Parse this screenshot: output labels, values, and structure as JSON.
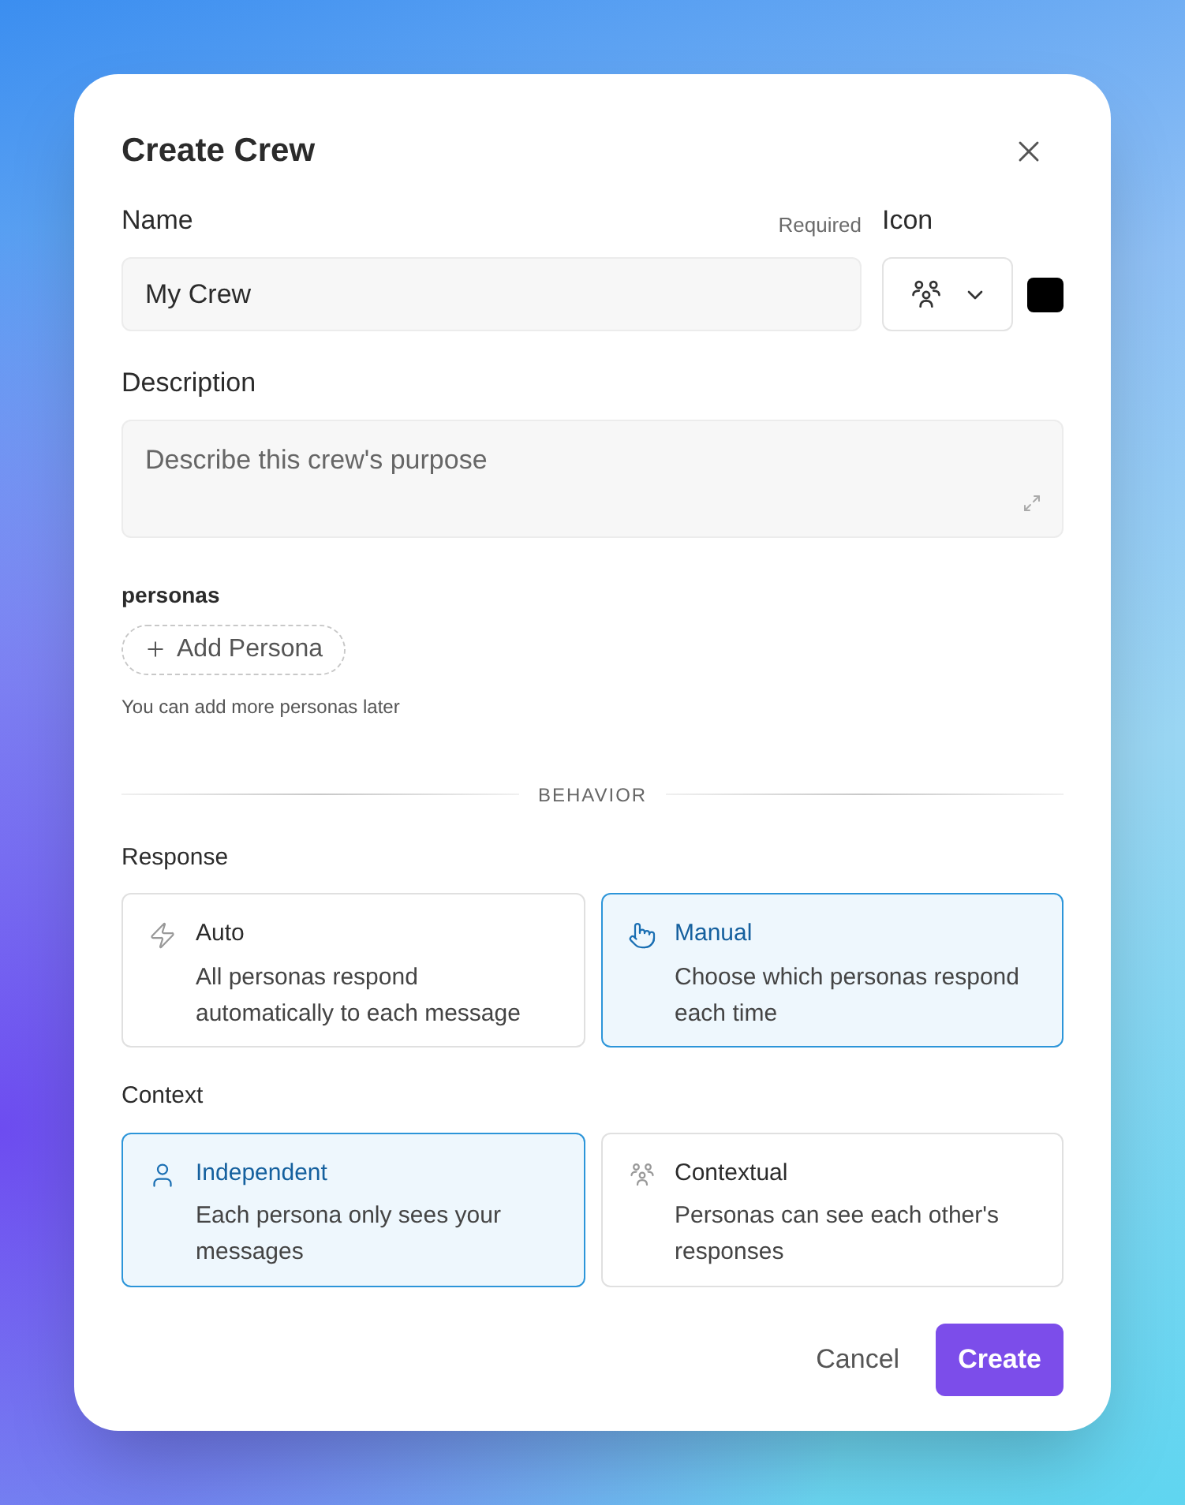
{
  "dialog": {
    "title": "Create Crew"
  },
  "name_field": {
    "label": "Name",
    "hint": "Required",
    "value": "My Crew"
  },
  "icon_picker": {
    "label": "Icon",
    "color": "#000000"
  },
  "description_field": {
    "label": "Description",
    "placeholder": "Describe this crew's purpose"
  },
  "personas": {
    "label": "personas",
    "add_button": "Add Persona",
    "helper": "You can add more personas later"
  },
  "divider": "BEHAVIOR",
  "option_groups": [
    {
      "label": "Response",
      "options": [
        {
          "title": "Auto",
          "description": "All personas respond automatically to each message",
          "selected": false
        },
        {
          "title": "Manual",
          "description": "Choose which personas respond each time",
          "selected": true
        }
      ]
    },
    {
      "label": "Context",
      "options": [
        {
          "title": "Independent",
          "description": "Each persona only sees your messages",
          "selected": true
        },
        {
          "title": "Contextual",
          "description": "Personas can see each other's responses",
          "selected": false
        }
      ]
    }
  ],
  "buttons": {
    "cancel": "Cancel",
    "create": "Create"
  }
}
